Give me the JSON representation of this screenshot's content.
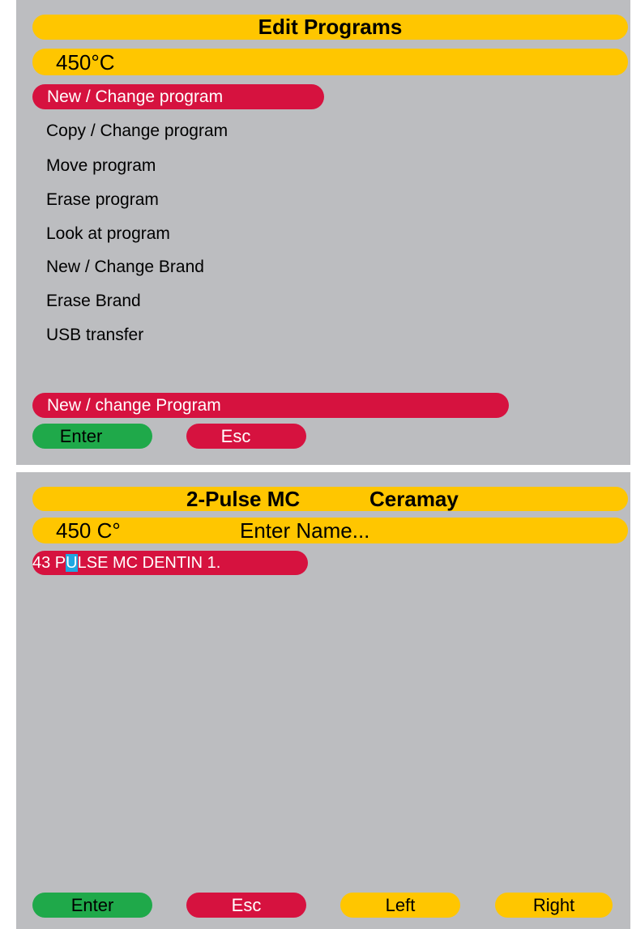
{
  "screen1": {
    "title": "Edit Programs",
    "temperature": "450°C",
    "selected_item": "New / Change program",
    "menu_items": [
      "Copy / Change program",
      "Move program",
      "Erase program",
      "Look at program",
      "New / Change Brand",
      "Erase Brand",
      "USB transfer"
    ],
    "status_label": "New / change Program",
    "buttons": {
      "enter": "Enter",
      "esc": "Esc"
    }
  },
  "screen2": {
    "title_left": "2-Pulse MC",
    "title_right": "Ceramay",
    "temperature": "450 C°",
    "prompt": "Enter Name...",
    "name_before_cursor": "43 P",
    "name_cursor_char": "U",
    "name_after_cursor": "LSE MC DENTIN 1.",
    "buttons": {
      "enter": "Enter",
      "esc": "Esc",
      "left": "Left",
      "right": "Right"
    }
  },
  "colors": {
    "panel_bg": "#bcbdc0",
    "yellow": "#ffc600",
    "red": "#d6123f",
    "green": "#1fa94a",
    "cursor": "#1ea7e1"
  }
}
